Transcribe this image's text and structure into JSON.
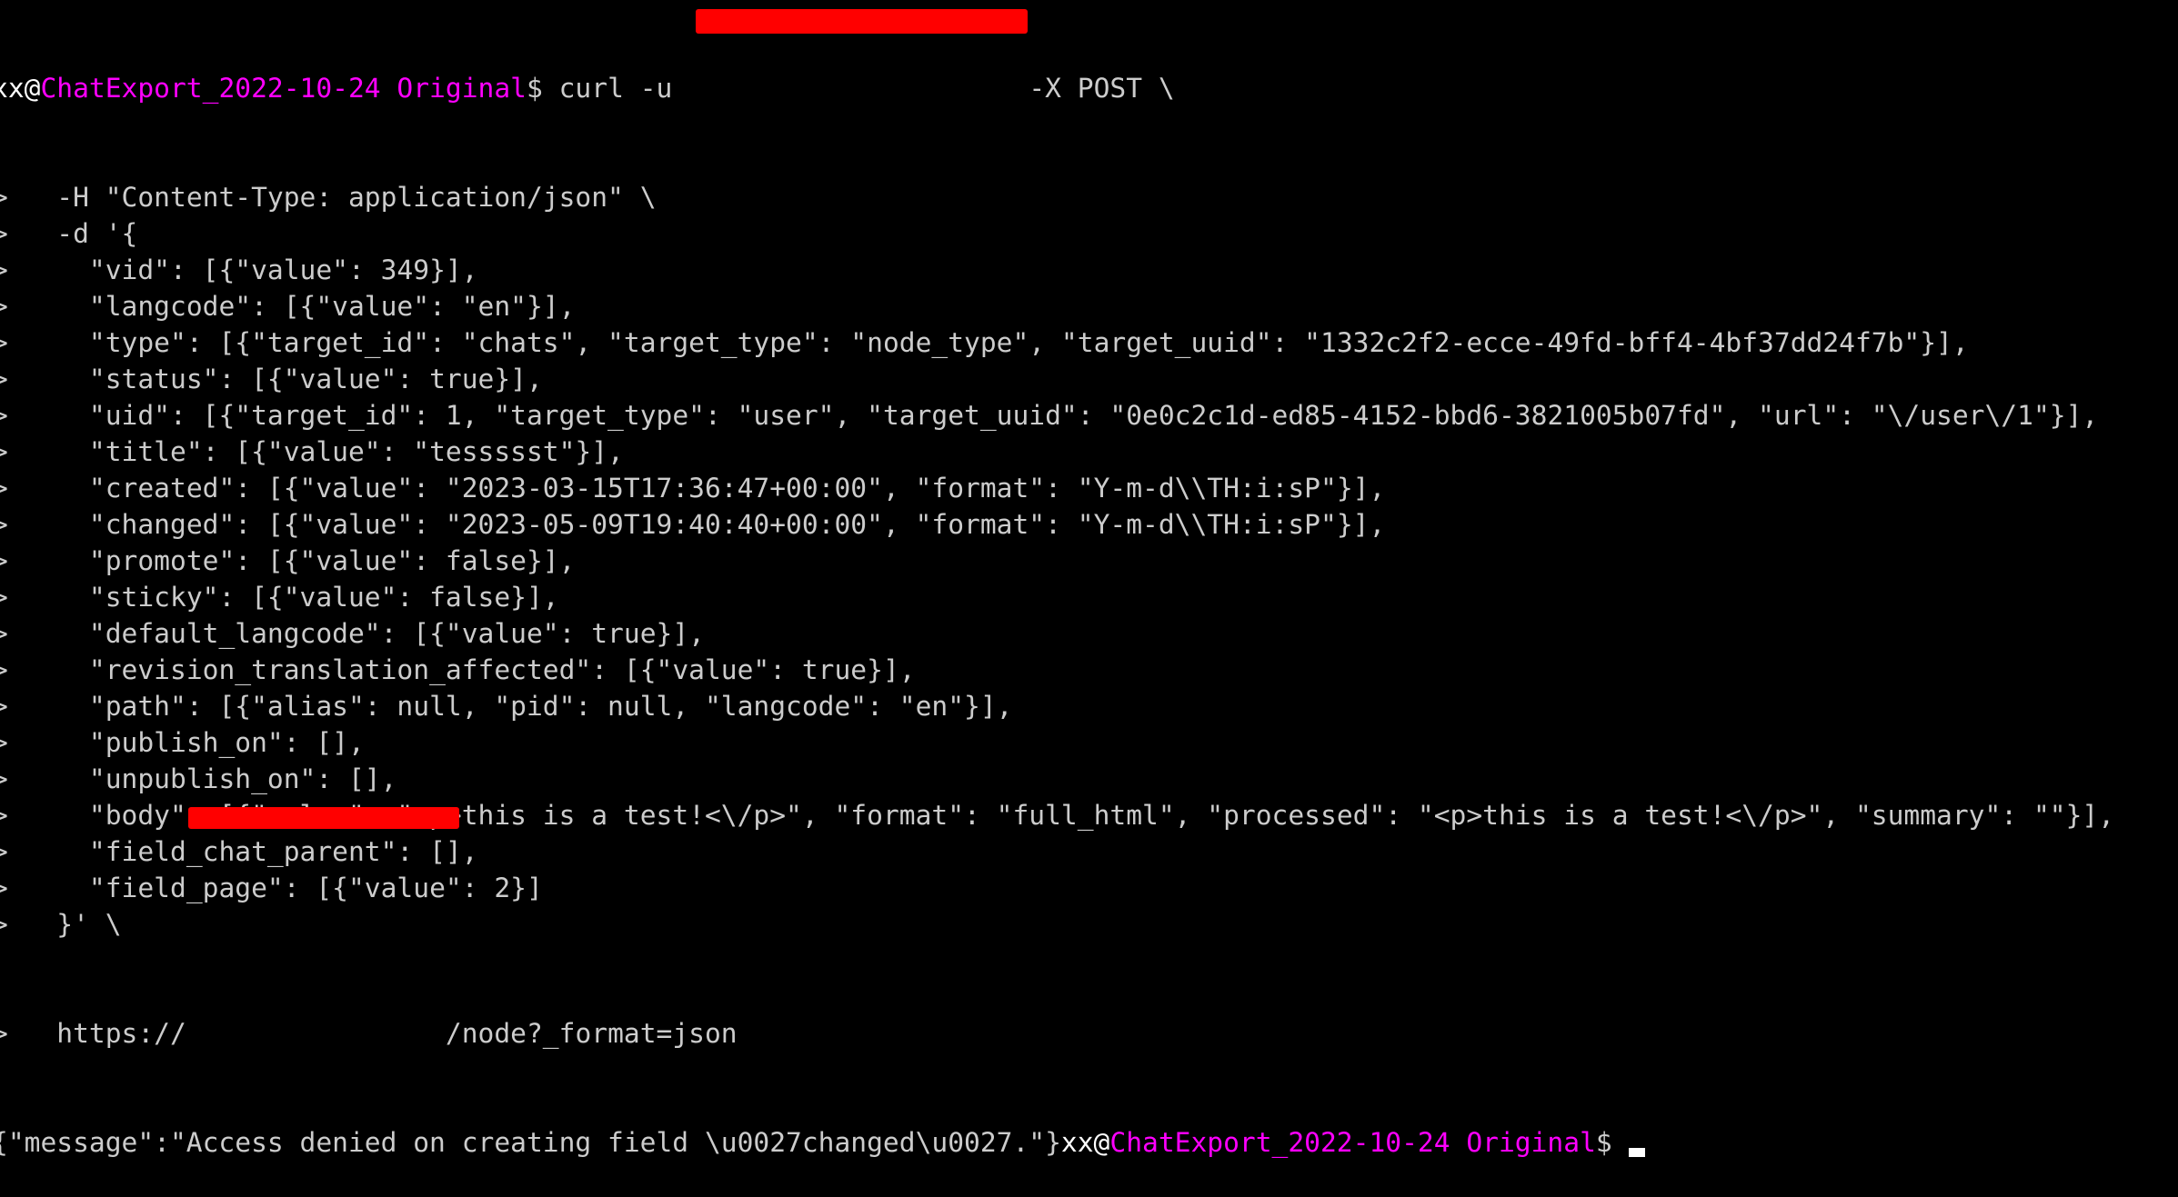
{
  "terminal": {
    "prompt": {
      "user": "xx@",
      "directory": "ChatExport_2022-10-24 Original",
      "symbol": "$"
    },
    "continuation_marker": ">",
    "command_first_line": " curl -u ",
    "command_first_line_tail": " -X POST \\",
    "command_lines": [
      "   -H \"Content-Type: application/json\" \\",
      "   -d '{",
      "     \"vid\": [{\"value\": 349}],",
      "     \"langcode\": [{\"value\": \"en\"}],",
      "     \"type\": [{\"target_id\": \"chats\", \"target_type\": \"node_type\", \"target_uuid\": \"1332c2f2-ecce-49fd-bff4-4bf37dd24f7b\"}],",
      "     \"status\": [{\"value\": true}],",
      "     \"uid\": [{\"target_id\": 1, \"target_type\": \"user\", \"target_uuid\": \"0e0c2c1d-ed85-4152-bbd6-3821005b07fd\", \"url\": \"\\/user\\/1\"}],",
      "     \"title\": [{\"value\": \"tessssst\"}],",
      "     \"created\": [{\"value\": \"2023-03-15T17:36:47+00:00\", \"format\": \"Y-m-d\\\\TH:i:sP\"}],",
      "     \"changed\": [{\"value\": \"2023-05-09T19:40:40+00:00\", \"format\": \"Y-m-d\\\\TH:i:sP\"}],",
      "     \"promote\": [{\"value\": false}],",
      "     \"sticky\": [{\"value\": false}],",
      "     \"default_langcode\": [{\"value\": true}],",
      "     \"revision_translation_affected\": [{\"value\": true}],",
      "     \"path\": [{\"alias\": null, \"pid\": null, \"langcode\": \"en\"}],",
      "     \"publish_on\": [],",
      "     \"unpublish_on\": [],",
      "     \"body\": [{\"value\": \"<p>this is a test!<\\/p>\", \"format\": \"full_html\", \"processed\": \"<p>this is a test!<\\/p>\", \"summary\": \"\"}],",
      "     \"field_chat_parent\": [],",
      "     \"field_page\": [{\"value\": 2}]",
      "   }' \\"
    ],
    "url_line_prefix": "   https://",
    "url_line_suffix": "/node?_format=json",
    "response": "{\"message\":\"Access denied on creating field \\u0027changed\\u0027.\"}",
    "redaction_color": "#ff0000",
    "colors": {
      "background": "#000000",
      "text": "#cccccc",
      "user": "#ffffff",
      "directory": "#ff00ff"
    }
  }
}
